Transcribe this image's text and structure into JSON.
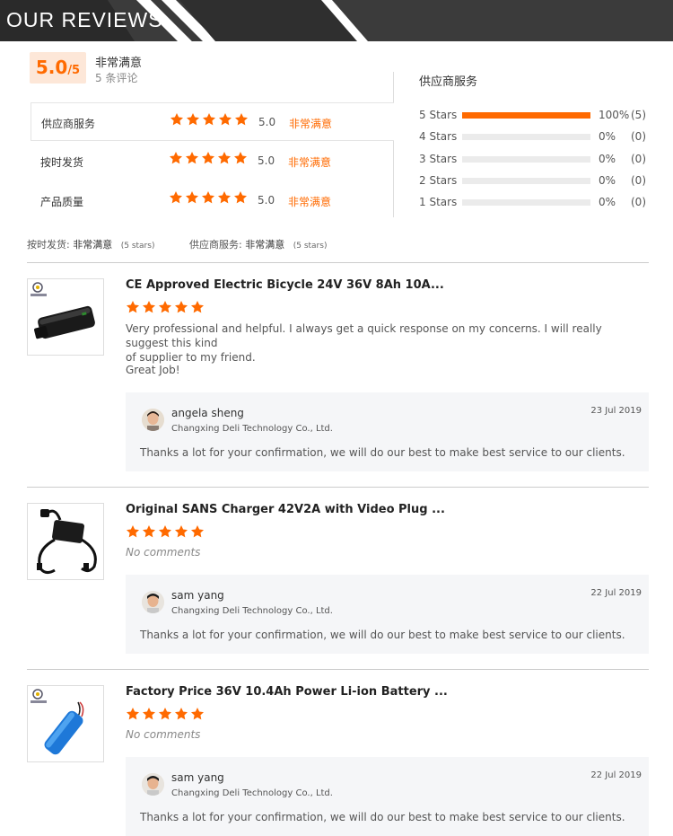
{
  "header": {
    "title": "OUR REVIEWS"
  },
  "summary": {
    "score": "5.0",
    "score_suffix": "/5",
    "satisfaction": "非常满意",
    "review_count": "5 条评论"
  },
  "ratings": [
    {
      "label": "供应商服务",
      "score": "5.0",
      "stars": 5,
      "satisfaction": "非常满意"
    },
    {
      "label": "按时发货",
      "score": "5.0",
      "stars": 5,
      "satisfaction": "非常满意"
    },
    {
      "label": "产品质量",
      "score": "5.0",
      "stars": 5,
      "satisfaction": "非常满意"
    }
  ],
  "breakdown": {
    "title": "供应商服务",
    "rows": [
      {
        "label": "5 Stars",
        "fraction": 1.0,
        "percent": "100%",
        "count": "(5)"
      },
      {
        "label": "4 Stars",
        "fraction": 0,
        "percent": "0%",
        "count": "(0)"
      },
      {
        "label": "3 Stars",
        "fraction": 0,
        "percent": "0%",
        "count": "(0)"
      },
      {
        "label": "2 Stars",
        "fraction": 0,
        "percent": "0%",
        "count": "(0)"
      },
      {
        "label": "1 Stars",
        "fraction": 0,
        "percent": "0%",
        "count": "(0)"
      }
    ]
  },
  "sub_ratings": [
    {
      "label": "按时发货:",
      "value": "非常满意",
      "count": "(5 stars)"
    },
    {
      "label": "供应商服务:",
      "value": "非常满意",
      "count": "(5 stars)"
    }
  ],
  "reviews": [
    {
      "product": "CE Approved Electric Bicycle 24V 36V 8Ah 10A...",
      "stars": 5,
      "text": [
        "Very professional and helpful. I always get a quick response on my concerns. I will really suggest this kind",
        "of supplier to my friend."
      ],
      "text2": "Great Job!",
      "thumb_icon": "battery-pack-image",
      "reply": {
        "name": "angela sheng",
        "company": "Changxing Deli Technology Co., Ltd.",
        "date": "23 Jul 2019",
        "text": "Thanks a lot for your confirmation, we will do our best to make best service to our clients."
      }
    },
    {
      "product": "Original SANS Charger 42V2A with Video Plug ...",
      "stars": 5,
      "no_comment": "No comments",
      "thumb_icon": "charger-image",
      "reply": {
        "name": "sam yang",
        "company": "Changxing Deli Technology Co., Ltd.",
        "date": "22 Jul 2019",
        "text": "Thanks a lot for your confirmation, we will do our best to make best service to our clients."
      }
    },
    {
      "product": "Factory Price 36V 10.4Ah Power Li-ion Battery ...",
      "stars": 5,
      "no_comment": "No comments",
      "thumb_icon": "blue-battery-image",
      "reply": {
        "name": "sam yang",
        "company": "Changxing Deli Technology Co., Ltd.",
        "date": "22 Jul 2019",
        "text": "Thanks a lot for your confirmation, we will do our best to make best service to our clients."
      }
    }
  ],
  "colors": {
    "accent": "#ff6a00",
    "banner": "#3b3b3b",
    "reply_bg": "#f5f6f8"
  }
}
